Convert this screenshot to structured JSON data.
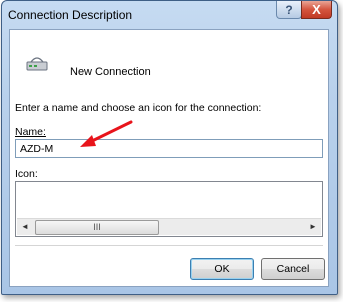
{
  "window": {
    "title": "Connection Description",
    "help_label": "?",
    "close_label": "X"
  },
  "connection": {
    "name": "New Connection",
    "icon": "modem-icon"
  },
  "prompt_text": "Enter a name and choose an icon for the connection:",
  "name_field": {
    "label": "Name:",
    "value": "AZD-M"
  },
  "icon_field": {
    "label": "Icon:",
    "scroll_left": "◄",
    "scroll_right": "►",
    "thumb_grip": "III"
  },
  "buttons": {
    "ok": "OK",
    "cancel": "Cancel"
  },
  "colors": {
    "annotation_arrow": "#e8141b",
    "close_button": "#c13a25",
    "title_bar": "#b9d1ec"
  }
}
